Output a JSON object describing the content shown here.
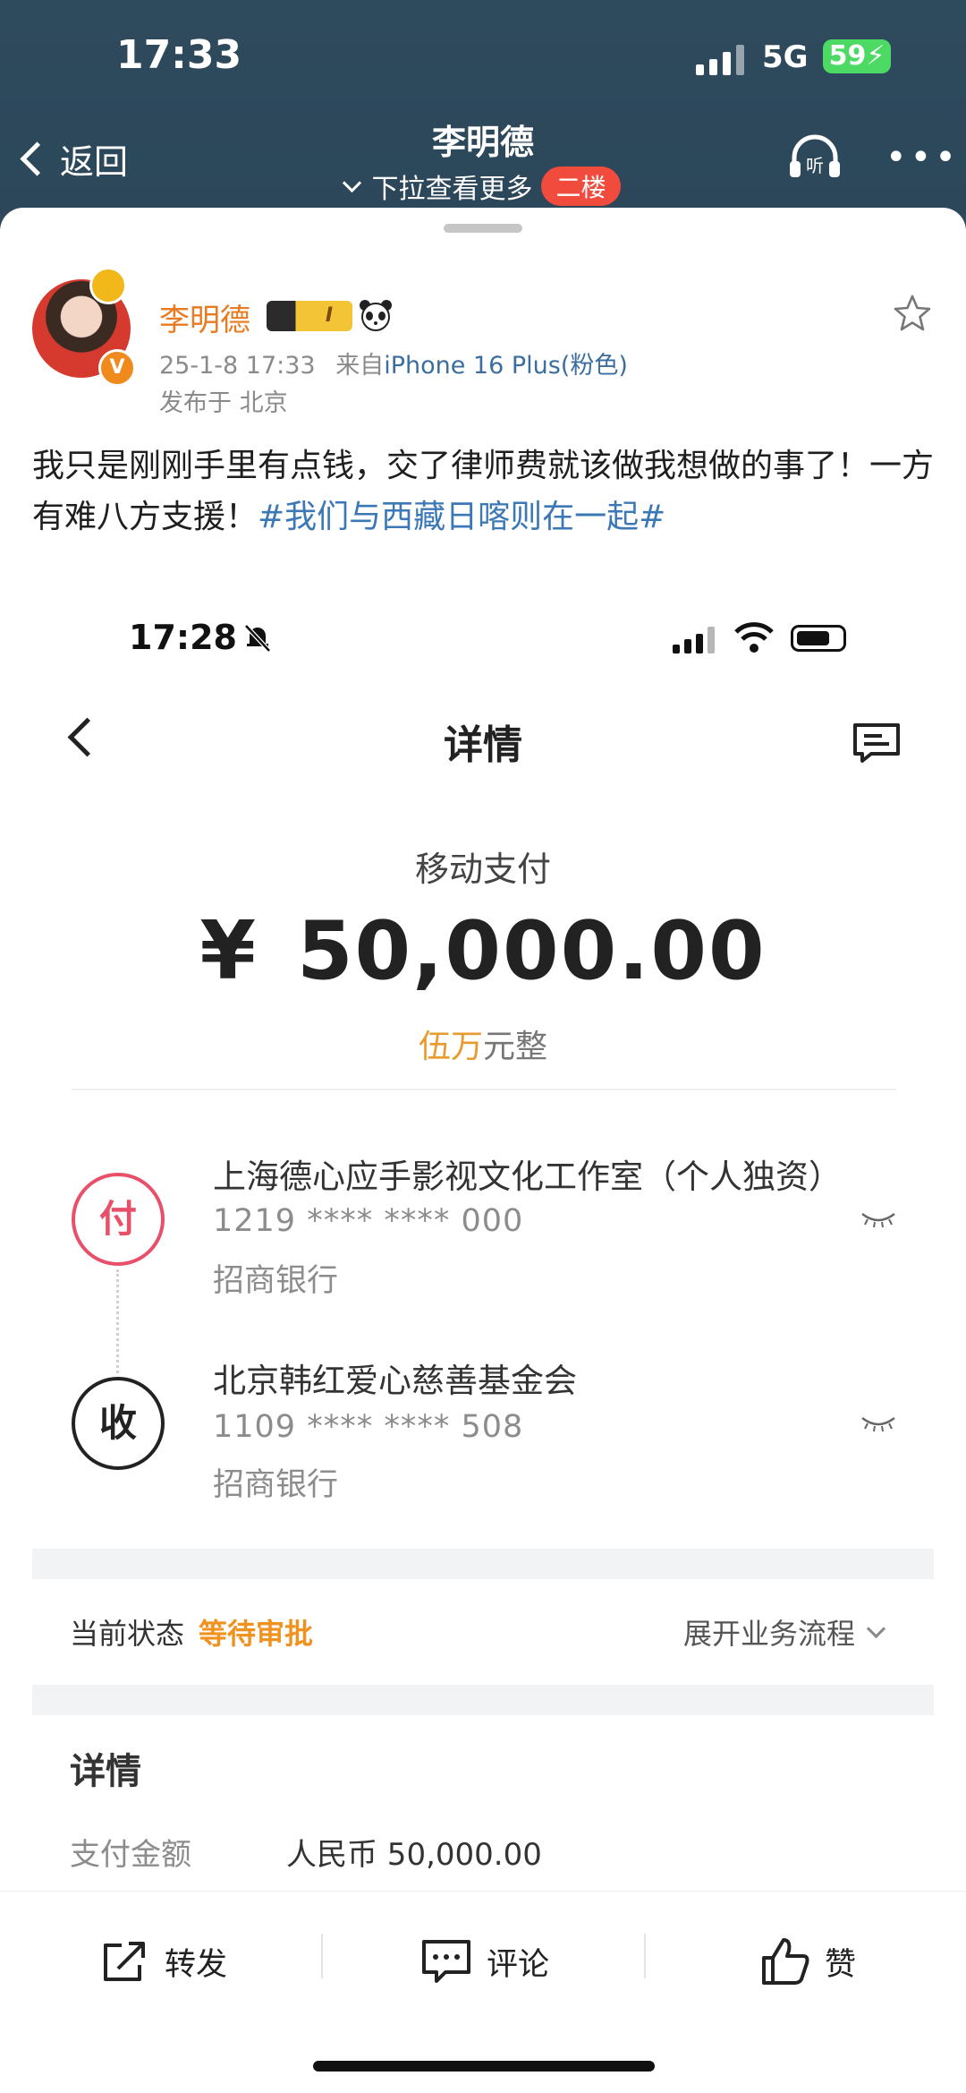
{
  "status_bar": {
    "time": "17:33",
    "network": "5G",
    "battery": "59"
  },
  "header": {
    "back_label": "返回",
    "title": "李明德",
    "subtitle": "下拉查看更多",
    "floor_badge": "二楼"
  },
  "post": {
    "username": "李明德",
    "level": "I",
    "date": "25-1-8 17:33",
    "source_prefix": "来自",
    "device": "iPhone 16 Plus(粉色)",
    "location": "发布于 北京",
    "text": "我只是刚刚手里有点钱，交了律师费就该做我想做的事了！一方有难八方支援！",
    "hashtag": "#我们与西藏日喀则在一起#"
  },
  "embedded": {
    "time": "17:28",
    "title": "详情",
    "pay_type": "移动支付",
    "currency_symbol": "¥",
    "amount": "50,000.00",
    "amount_upper_hl": "伍万",
    "amount_upper_rest": "元整",
    "payer": {
      "badge": "付",
      "name": "上海德心应手影视文化工作室（个人独资）",
      "account": "1219 **** **** 000",
      "bank": "招商银行"
    },
    "payee": {
      "badge": "收",
      "name": "北京韩红爱心慈善基金会",
      "account": "1109 **** **** 508",
      "bank": "招商银行"
    },
    "status_label": "当前状态",
    "status_value": "等待审批",
    "flow_link": "展开业务流程",
    "details_heading": "详情",
    "detail_rows": [
      {
        "label": "支付金额",
        "value": "人民币 50,000.00"
      }
    ]
  },
  "actions": {
    "repost": "转发",
    "comment": "评论",
    "like": "赞"
  },
  "colors": {
    "header_bg": "#2e4a5d",
    "username": "#e87a1f",
    "hashtag": "#3b78b5",
    "status_pending": "#f0921f",
    "pay_badge": "#e8506a"
  }
}
